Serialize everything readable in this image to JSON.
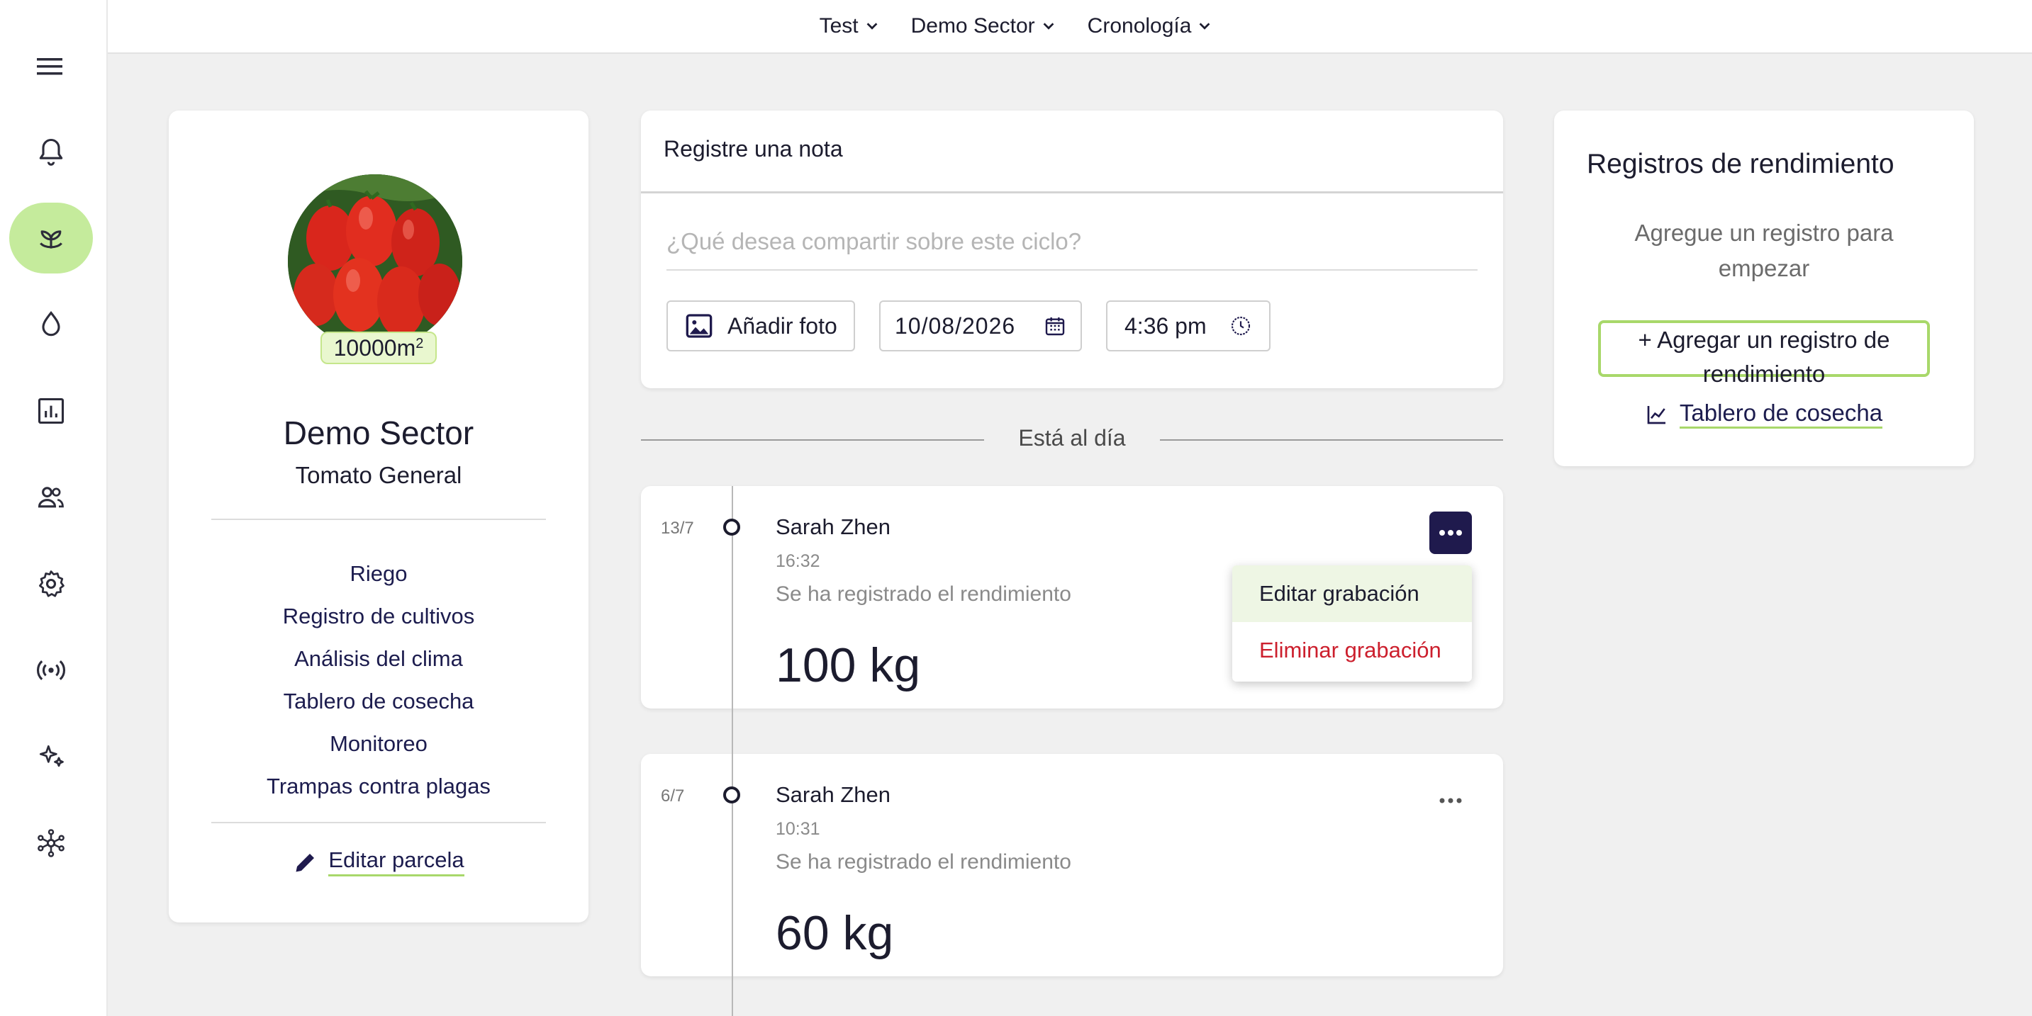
{
  "topbar": {
    "crumbs": [
      {
        "label": "Test"
      },
      {
        "label": "Demo Sector"
      },
      {
        "label": "Cronología"
      }
    ]
  },
  "sidebar": {
    "items": [
      {
        "icon": "bell-icon"
      },
      {
        "icon": "plant-icon",
        "active": true
      },
      {
        "icon": "water-drop-icon"
      },
      {
        "icon": "chart-icon"
      },
      {
        "icon": "people-icon"
      },
      {
        "icon": "gear-icon"
      },
      {
        "icon": "broadcast-icon"
      },
      {
        "icon": "sparkles-icon"
      },
      {
        "icon": "network-icon"
      }
    ]
  },
  "plot": {
    "area_value": "10000m",
    "area_exp": "2",
    "name": "Demo Sector",
    "crop": "Tomato General",
    "links": [
      "Riego",
      "Registro de cultivos",
      "Análisis del clima",
      "Tablero de cosecha",
      "Monitoreo",
      "Trampas contra plagas"
    ],
    "edit_label": "Editar parcela"
  },
  "note": {
    "title": "Registre una nota",
    "placeholder": "¿Qué desea compartir sobre este ciclo?",
    "add_photo": "Añadir foto",
    "date": "10/08/2026",
    "time": "4:36 pm"
  },
  "status": {
    "up_to_date": "Está al día"
  },
  "timeline": [
    {
      "date": "13/7",
      "author": "Sarah Zhen",
      "time": "16:32",
      "description": "Se ha registrado el rendimiento",
      "amount": "100 kg"
    },
    {
      "date": "6/7",
      "author": "Sarah Zhen",
      "time": "10:31",
      "description": "Se ha registrado el rendimiento",
      "amount": "60 kg"
    }
  ],
  "menu": {
    "edit": "Editar grabación",
    "delete": "Eliminar grabación"
  },
  "yield": {
    "title": "Registros de rendimiento",
    "subtitle": "Agregue un registro para empezar",
    "add_button": "+ Agregar un registro de rendimiento",
    "harvest_link": "Tablero de cosecha"
  },
  "colors": {
    "accent": "#c5eb9c",
    "primary": "#1f1a4d",
    "danger": "#cc1f2d"
  }
}
